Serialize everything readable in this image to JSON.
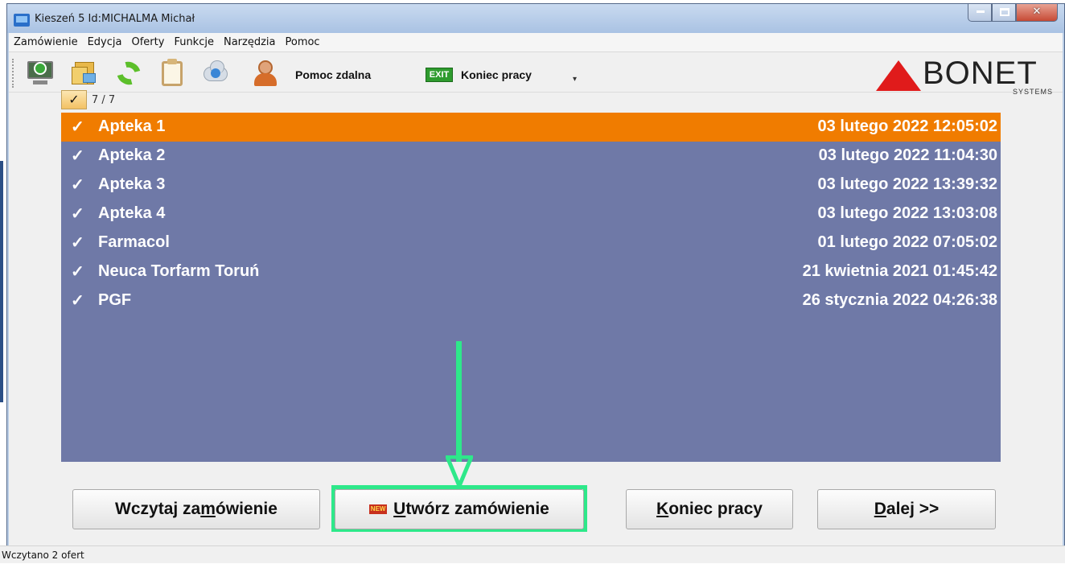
{
  "window": {
    "title": "Kieszeń 5  Id:MICHALMA    Michał"
  },
  "menu": [
    "Zamówienie",
    "Edycja",
    "Oferty",
    "Funkcje",
    "Narzędzia",
    "Pomoc"
  ],
  "toolbar": {
    "remote_help_label": "Pomoc zdalna",
    "exit_badge": "EXIT",
    "end_work_label": "Koniec pracy",
    "more_glyph": "▾",
    "icons": [
      "download-monitor-icon",
      "folders-icon",
      "refresh-icon",
      "clipboard-icon",
      "cloud-download-icon",
      "person-support-icon"
    ]
  },
  "logo": {
    "word": "BONET",
    "sub": "SYSTEMS",
    "accent": "#e01b1b"
  },
  "filter": {
    "check_glyph": "✓",
    "count": "7 / 7"
  },
  "list": {
    "selected_color": "#f07c00",
    "background_color": "#6f79a7",
    "rows": [
      {
        "check": "✓",
        "name": "Apteka 1",
        "date": "03 lutego 2022  12:05:02",
        "selected": true
      },
      {
        "check": "✓",
        "name": "Apteka 2",
        "date": "03 lutego 2022  11:04:30",
        "selected": false
      },
      {
        "check": "✓",
        "name": "Apteka 3",
        "date": "03 lutego 2022  13:39:32",
        "selected": false
      },
      {
        "check": "✓",
        "name": "Apteka 4",
        "date": "03 lutego 2022  13:03:08",
        "selected": false
      },
      {
        "check": "✓",
        "name": "Farmacol",
        "date": "01 lutego 2022  07:05:02",
        "selected": false
      },
      {
        "check": "✓",
        "name": "Neuca Torfarm Toruń",
        "date": "21 kwietnia 2021  01:45:42",
        "selected": false
      },
      {
        "check": "✓",
        "name": "PGF",
        "date": "26 stycznia 2022  04:26:38",
        "selected": false
      }
    ]
  },
  "buttons": {
    "load_order": {
      "pre": "Wczytaj za",
      "u": "m",
      "post": "ówienie"
    },
    "create_order": {
      "badge": "NEW",
      "pre": "",
      "u": "U",
      "post": "twórz zamówienie"
    },
    "end_work": {
      "pre": "",
      "u": "K",
      "post": "oniec pracy"
    },
    "next": {
      "pre": "",
      "u": "D",
      "post": "alej >>"
    }
  },
  "annotation": {
    "color": "#2ee88a"
  },
  "status": {
    "text": "Wczytano 2 ofert"
  }
}
